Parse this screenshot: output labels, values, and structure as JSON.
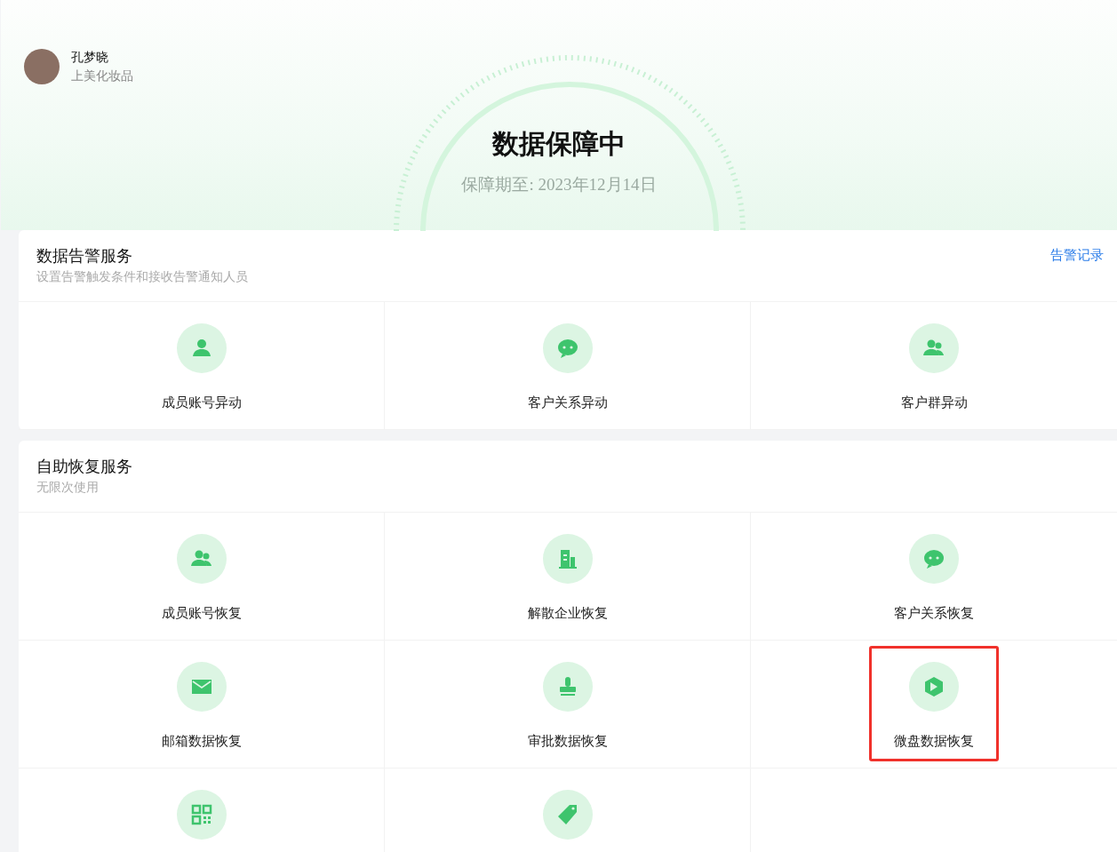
{
  "user": {
    "name": "孔梦晓",
    "company": "上美化妆品"
  },
  "hero": {
    "title": "数据保障中",
    "subtitle": "保障期至: 2023年12月14日"
  },
  "sections": [
    {
      "title": "数据告警服务",
      "subtitle": "设置告警触发条件和接收告警通知人员",
      "link": "告警记录",
      "items": [
        {
          "label": "成员账号异动",
          "highlighted": false
        },
        {
          "label": "客户关系异动",
          "highlighted": false
        },
        {
          "label": "客户群异动",
          "highlighted": false
        }
      ]
    },
    {
      "title": "自助恢复服务",
      "subtitle": "无限次使用",
      "items": [
        {
          "label": "成员账号恢复",
          "highlighted": false
        },
        {
          "label": "解散企业恢复",
          "highlighted": false
        },
        {
          "label": "客户关系恢复",
          "highlighted": false
        },
        {
          "label": "邮箱数据恢复",
          "highlighted": false
        },
        {
          "label": "审批数据恢复",
          "highlighted": false
        },
        {
          "label": "微盘数据恢复",
          "highlighted": true
        },
        {
          "highlighted": false
        },
        {
          "highlighted": false
        }
      ]
    }
  ]
}
